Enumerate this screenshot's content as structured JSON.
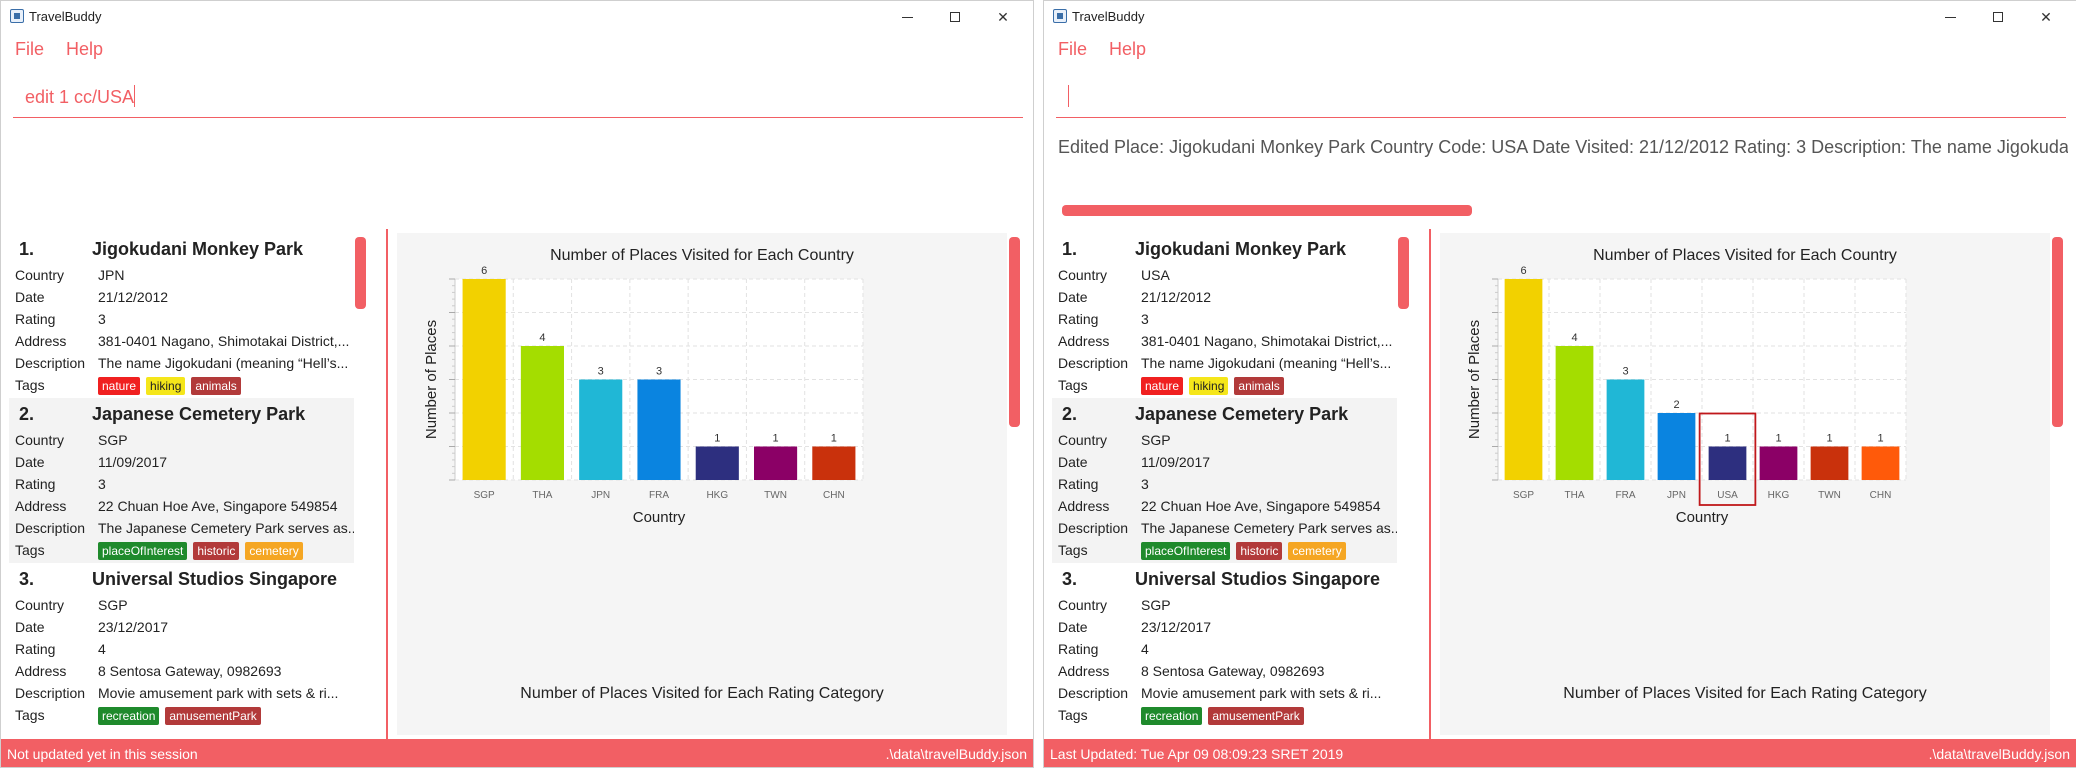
{
  "app_title": "TravelBuddy",
  "menu": {
    "file": "File",
    "help": "Help"
  },
  "colors": {
    "accent": "#f25f64"
  },
  "left": {
    "command_input": "edit 1 cc/USA",
    "result_text": "",
    "status_left": "Not updated yet in this session",
    "status_right": ".\\data\\travelBuddy.json",
    "places": [
      {
        "index": "1.",
        "name": "Jigokudani Monkey Park",
        "country": "JPN",
        "date": "21/12/2012",
        "rating": "3",
        "address": "381-0401 Nagano, Shimotakai District,...",
        "description": "The name Jigokudani (meaning “Hell’s...",
        "tags": [
          {
            "label": "nature",
            "color": "#f02020"
          },
          {
            "label": "hiking",
            "color": "#f5e61a"
          },
          {
            "label": "animals",
            "color": "#b23a3a"
          }
        ]
      },
      {
        "index": "2.",
        "name": "Japanese Cemetery Park",
        "country": "SGP",
        "date": "11/09/2017",
        "rating": "3",
        "address": "22 Chuan Hoe Ave, Singapore 549854",
        "description": "The Japanese Cemetery Park serves as...",
        "tags": [
          {
            "label": "placeOfInterest",
            "color": "#1f8a2c"
          },
          {
            "label": "historic",
            "color": "#b23a3a"
          },
          {
            "label": "cemetery",
            "color": "#f5a623"
          }
        ]
      },
      {
        "index": "3.",
        "name": "Universal Studios Singapore",
        "country": "SGP",
        "date": "23/12/2017",
        "rating": "4",
        "address": "8 Sentosa Gateway, 0982693",
        "description": "Movie amusement park with sets & ri...",
        "tags": [
          {
            "label": "recreation",
            "color": "#1f8a2c"
          },
          {
            "label": "amusementPark",
            "color": "#b23a3a"
          }
        ]
      }
    ],
    "labels": {
      "country": "Country",
      "date": "Date",
      "rating": "Rating",
      "address": "Address",
      "description": "Description",
      "tags": "Tags"
    },
    "chart_data": {
      "type": "bar",
      "title": "Number of Places Visited for Each Country",
      "xlabel": "Country",
      "ylabel": "Number of Places",
      "categories": [
        "SGP",
        "THA",
        "JPN",
        "FRA",
        "HKG",
        "TWN",
        "CHN"
      ],
      "values": [
        6,
        4,
        3,
        3,
        1,
        1,
        1
      ],
      "colors": [
        "#f2d100",
        "#a4dd00",
        "#20b7d6",
        "#0a84e0",
        "#2d2f7f",
        "#8b0066",
        "#c9310c"
      ],
      "ylim": [
        0,
        6
      ],
      "grid": true
    },
    "second_chart_title": "Number of Places Visited for Each Rating Category"
  },
  "right": {
    "command_input": "",
    "result_text": "Edited Place: Jigokudani Monkey Park Country Code: USA Date Visited: 21/12/2012 Rating: 3 Description: The name Jigokudani (mea",
    "status_left": "Last Updated: Tue Apr 09 08:09:23 SRET 2019",
    "status_right": ".\\data\\travelBuddy.json",
    "places": [
      {
        "index": "1.",
        "name": "Jigokudani Monkey Park",
        "country": "USA",
        "date": "21/12/2012",
        "rating": "3",
        "address": "381-0401 Nagano, Shimotakai District,...",
        "description": "The name Jigokudani (meaning “Hell’s...",
        "tags": [
          {
            "label": "nature",
            "color": "#f02020"
          },
          {
            "label": "hiking",
            "color": "#f5e61a"
          },
          {
            "label": "animals",
            "color": "#b23a3a"
          }
        ]
      },
      {
        "index": "2.",
        "name": "Japanese Cemetery Park",
        "country": "SGP",
        "date": "11/09/2017",
        "rating": "3",
        "address": "22 Chuan Hoe Ave, Singapore 549854",
        "description": "The Japanese Cemetery Park serves as...",
        "tags": [
          {
            "label": "placeOfInterest",
            "color": "#1f8a2c"
          },
          {
            "label": "historic",
            "color": "#b23a3a"
          },
          {
            "label": "cemetery",
            "color": "#f5a623"
          }
        ]
      },
      {
        "index": "3.",
        "name": "Universal Studios Singapore",
        "country": "SGP",
        "date": "23/12/2017",
        "rating": "4",
        "address": "8 Sentosa Gateway, 0982693",
        "description": "Movie amusement park with sets & ri...",
        "tags": [
          {
            "label": "recreation",
            "color": "#1f8a2c"
          },
          {
            "label": "amusementPark",
            "color": "#b23a3a"
          }
        ]
      }
    ],
    "labels": {
      "country": "Country",
      "date": "Date",
      "rating": "Rating",
      "address": "Address",
      "description": "Description",
      "tags": "Tags"
    },
    "chart_data": {
      "type": "bar",
      "title": "Number of Places Visited for Each Country",
      "xlabel": "Country",
      "ylabel": "Number of Places",
      "categories": [
        "SGP",
        "THA",
        "FRA",
        "JPN",
        "USA",
        "HKG",
        "TWN",
        "CHN"
      ],
      "values": [
        6,
        4,
        3,
        2,
        1,
        1,
        1,
        1
      ],
      "colors": [
        "#f2d100",
        "#a4dd00",
        "#20b7d6",
        "#0a84e0",
        "#2d2f7f",
        "#8b0066",
        "#c9310c",
        "#ff5a0a"
      ],
      "highlight": "USA",
      "ylim": [
        0,
        6
      ],
      "grid": true
    },
    "second_chart_title": "Number of Places Visited for Each Rating Category"
  }
}
